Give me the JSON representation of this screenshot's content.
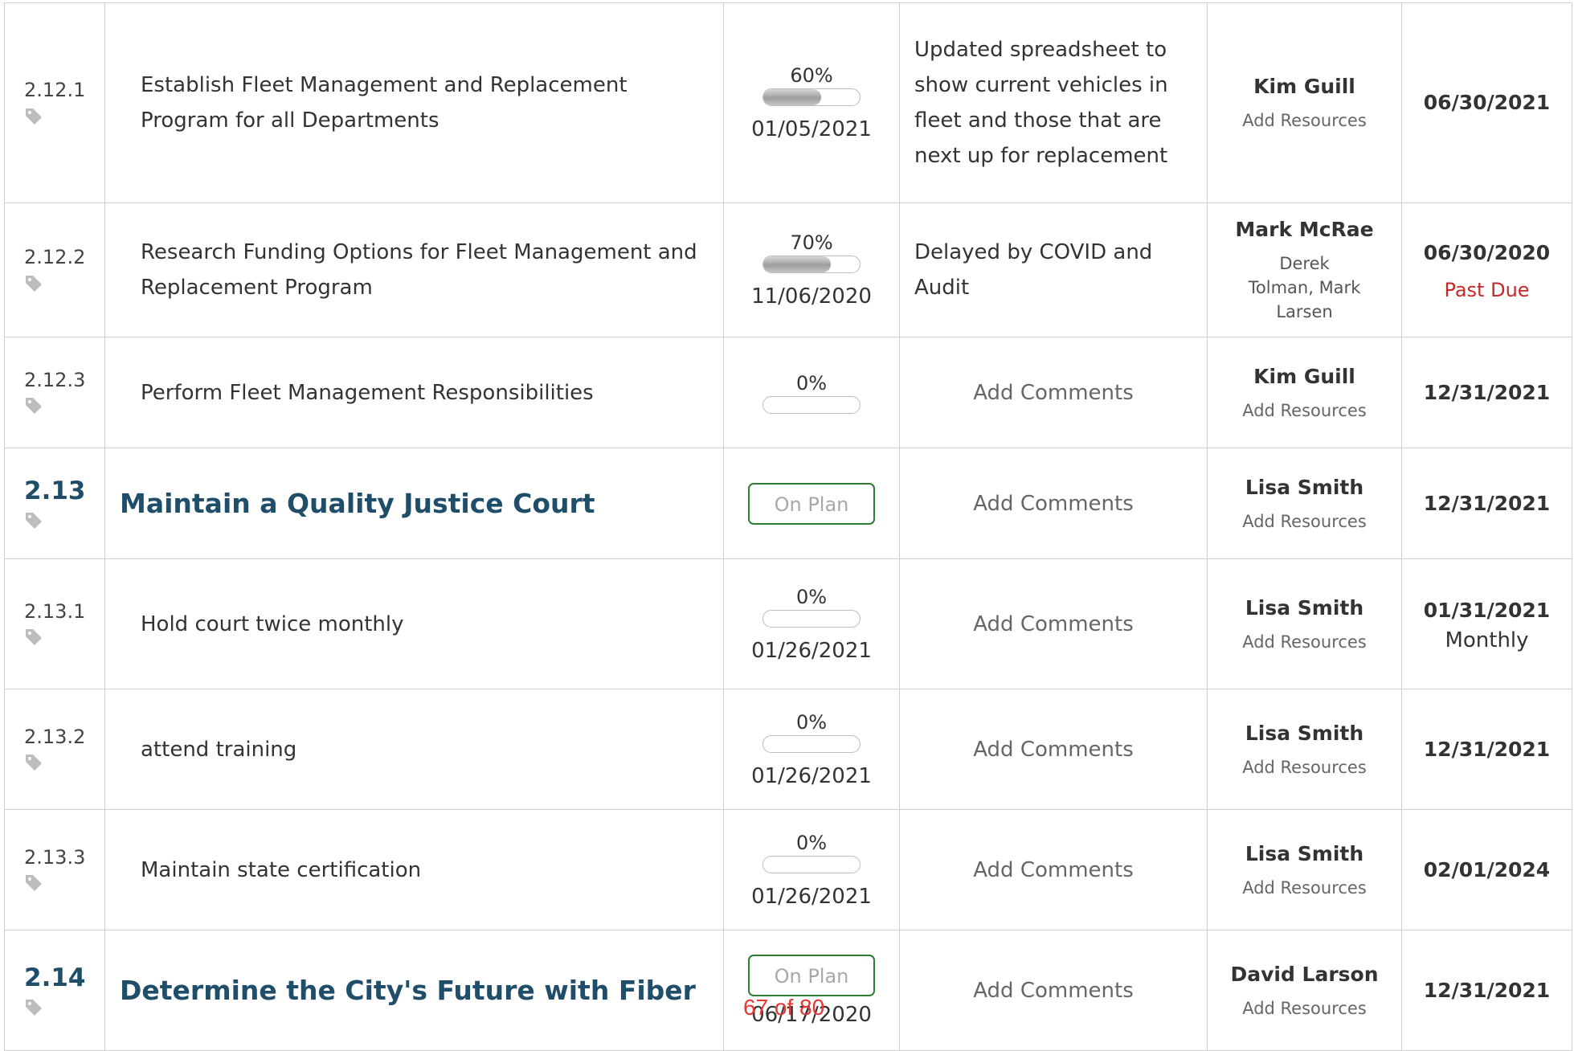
{
  "rows": [
    {
      "num": "2.12.1",
      "name": "Establish Fleet Management and Replacement Program for all Departments",
      "percent": "60%",
      "progress": 0.6,
      "date": "01/05/2021",
      "comment": "Updated spreadsheet to show current vehicles in fleet and those that are next up for replacement",
      "owner": "Kim Guill",
      "resources": "Add Resources",
      "due": "06/30/2021"
    },
    {
      "num": "2.12.2",
      "name": "Research Funding Options for Fleet Management and Replacement Program",
      "percent": "70%",
      "progress": 0.7,
      "date": "11/06/2020",
      "comment": "Delayed by COVID and Audit",
      "owner": "Mark McRae",
      "resources": "Derek Tolman, Mark Larsen",
      "due": "06/30/2020",
      "due_note": "Past Due"
    },
    {
      "num": "2.12.3",
      "name": "Perform Fleet Management Responsibilities",
      "percent": "0%",
      "progress": 0,
      "comment": "Add Comments",
      "owner": "Kim Guill",
      "resources": "Add Resources",
      "due": "12/31/2021"
    },
    {
      "num": "2.13",
      "name": "Maintain a Quality Justice Court",
      "status": "On Plan",
      "comment": "Add Comments",
      "owner": "Lisa Smith",
      "resources": "Add Resources",
      "due": "12/31/2021"
    },
    {
      "num": "2.13.1",
      "name": "Hold court twice monthly",
      "percent": "0%",
      "progress": 0,
      "date": "01/26/2021",
      "comment": "Add Comments",
      "owner": "Lisa Smith",
      "resources": "Add Resources",
      "due": "01/31/2021",
      "frequency": "Monthly"
    },
    {
      "num": "2.13.2",
      "name": "attend training",
      "percent": "0%",
      "progress": 0,
      "date": "01/26/2021",
      "comment": "Add Comments",
      "owner": "Lisa Smith",
      "resources": "Add Resources",
      "due": "12/31/2021"
    },
    {
      "num": "2.13.3",
      "name": "Maintain state certification",
      "percent": "0%",
      "progress": 0,
      "date": "01/26/2021",
      "comment": "Add Comments",
      "owner": "Lisa Smith",
      "resources": "Add Resources",
      "due": "02/01/2024"
    },
    {
      "num": "2.14",
      "name": "Determine the City's Future with Fiber",
      "status": "On Plan",
      "date": "06/17/2020",
      "comment": "Add Comments",
      "owner": "David Larson",
      "resources": "Add Resources",
      "due": "12/31/2021"
    }
  ],
  "pager": "67 of 80",
  "colors": {
    "goal": "#1f4e6b",
    "on_plan_border": "#2e7d32",
    "past_due": "#c62828",
    "pager": "#e53935"
  }
}
